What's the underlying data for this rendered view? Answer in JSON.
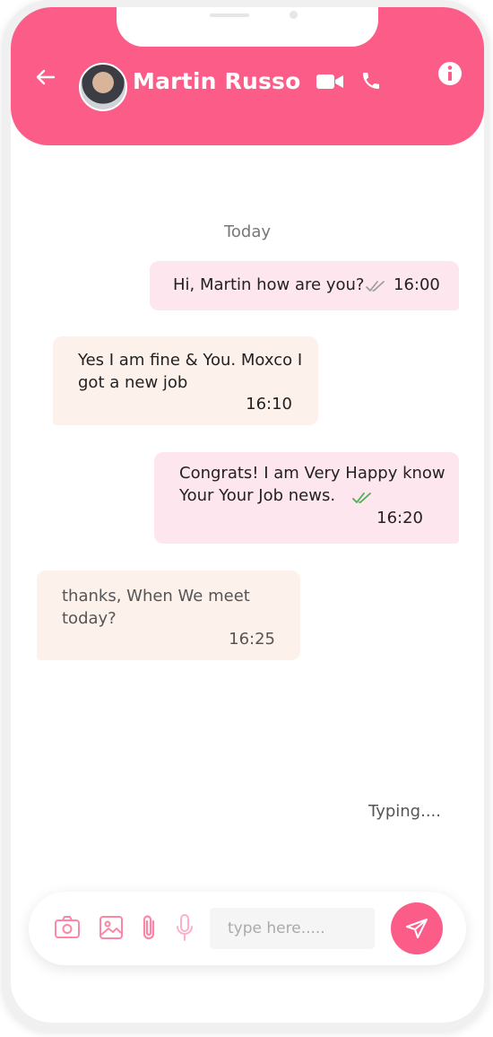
{
  "colors": {
    "accent": "#fc5c88",
    "outgoing_bubble": "#fde6ee",
    "incoming_bubble": "#fdf1ec",
    "read_tick": "#4caf50"
  },
  "header": {
    "contact_name": "Martin Russo",
    "icons": [
      "back-arrow-icon",
      "avatar",
      "video-call-icon",
      "phone-icon",
      "info-icon"
    ]
  },
  "chat": {
    "date_divider": "Today",
    "messages": [
      {
        "direction": "outgoing",
        "text": "Hi, Martin how are you?",
        "time": "16:00",
        "status": "read"
      },
      {
        "direction": "incoming",
        "text": "Yes I am fine & You. Moxco I got a new job",
        "time": "16:10"
      },
      {
        "direction": "outgoing",
        "text": "Congrats! I am Very Happy know Your Your Job news.",
        "time": "16:20",
        "status": "read"
      },
      {
        "direction": "incoming",
        "text": "thanks, When We meet today?",
        "time": "16:25"
      }
    ],
    "typing_indicator": "Typing...."
  },
  "composer": {
    "placeholder": "type here.....",
    "value": "",
    "icons": [
      "camera-icon",
      "gallery-icon",
      "attach-icon",
      "mic-icon",
      "send-icon"
    ]
  }
}
